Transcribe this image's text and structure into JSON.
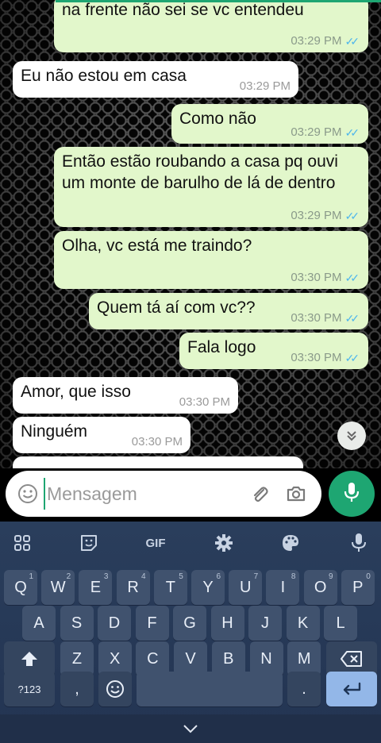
{
  "messages": [
    {
      "dir": "out",
      "text": "na frente não sei se vc entendeu",
      "time": "03:29 PM",
      "read": true
    },
    {
      "dir": "in",
      "text": "Eu não estou em casa",
      "time": "03:29 PM"
    },
    {
      "dir": "out",
      "text": "Como não",
      "time": "03:29 PM",
      "read": true
    },
    {
      "dir": "out",
      "text": "Então estão roubando a casa pq ouvi um monte de barulho de lá de dentro",
      "time": "03:29 PM",
      "read": true
    },
    {
      "dir": "out",
      "text": "Olha, vc está me traindo?",
      "time": "03:30 PM",
      "read": true
    },
    {
      "dir": "out",
      "text": "Quem tá aí com vc??",
      "time": "03:30 PM",
      "read": true
    },
    {
      "dir": "out",
      "text": "Fala logo",
      "time": "03:30 PM",
      "read": true
    },
    {
      "dir": "in",
      "text": "Amor, que isso",
      "time": "03:30 PM"
    },
    {
      "dir": "in",
      "text": "Ninguém",
      "time": "03:30 PM"
    }
  ],
  "composer": {
    "placeholder": "Mensagem"
  },
  "keyboard": {
    "toolbar": {
      "gif": "GIF"
    },
    "row1": [
      {
        "k": "Q",
        "s": "1"
      },
      {
        "k": "W",
        "s": "2"
      },
      {
        "k": "E",
        "s": "3"
      },
      {
        "k": "R",
        "s": "4"
      },
      {
        "k": "T",
        "s": "5"
      },
      {
        "k": "Y",
        "s": "6"
      },
      {
        "k": "U",
        "s": "7"
      },
      {
        "k": "I",
        "s": "8"
      },
      {
        "k": "O",
        "s": "9"
      },
      {
        "k": "P",
        "s": "0"
      }
    ],
    "row2": [
      "A",
      "S",
      "D",
      "F",
      "G",
      "H",
      "J",
      "K",
      "L"
    ],
    "row3": [
      "Z",
      "X",
      "C",
      "V",
      "B",
      "N",
      "M"
    ],
    "symbols_label": "?123",
    "comma": ",",
    "period": "."
  },
  "icons": {
    "emoji": "emoji-icon",
    "attach": "paperclip-icon",
    "camera": "camera-icon",
    "mic": "microphone-icon",
    "scroll": "chevron-double-down-icon"
  },
  "colors": {
    "accent": "#1ea672",
    "outgoing": "#e2f7cb",
    "incoming": "#ffffff",
    "ticks": "#4fb6ec",
    "keyboard": "#2a3e5c"
  }
}
